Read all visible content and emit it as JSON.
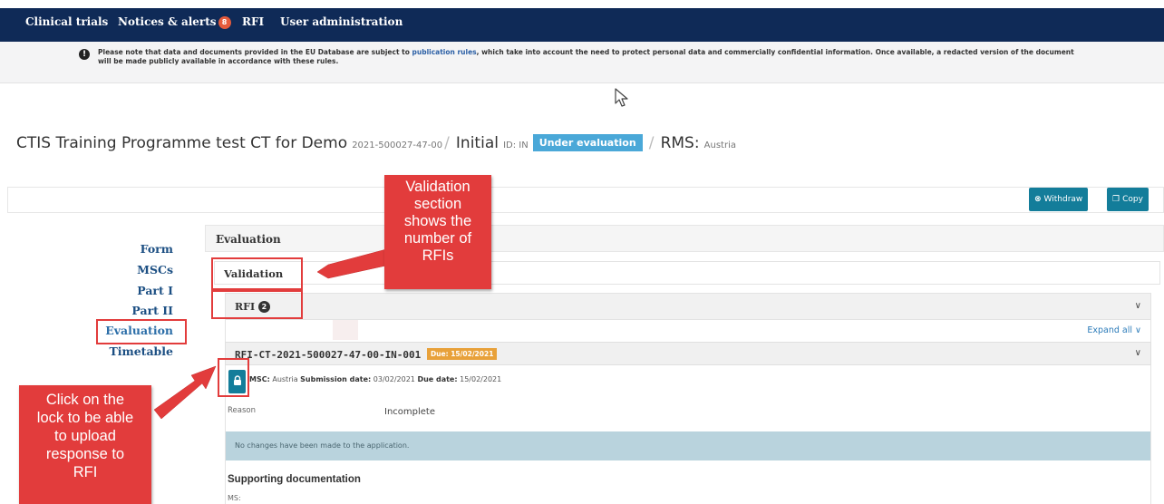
{
  "nav": {
    "items": [
      "Clinical trials",
      "Notices & alerts",
      "RFI",
      "User administration"
    ],
    "alerts_count": "8"
  },
  "notice": {
    "line1_before": "Please note that data and documents provided in the EU Database are subject to ",
    "line1_link": "publication rules",
    "line1_after": ", which take into account the need to protect personal data and commercially confidential information. Once available, a redacted version of the document",
    "line2": "will be made publicly available in accordance with these rules."
  },
  "trial": {
    "title": "CTIS Training Programme test CT for Demo",
    "number": "2021-500027-47-00",
    "phase": "Initial",
    "id_label": "ID: IN",
    "status": "Under evaluation",
    "rms_label": "RMS:",
    "rms_value": "Austria"
  },
  "actions": {
    "withdraw": "Withdraw",
    "copy": "Copy"
  },
  "sidebar": {
    "items": [
      "Form",
      "MSCs",
      "Part I",
      "Part II",
      "Evaluation",
      "Timetable"
    ],
    "active": "Evaluation"
  },
  "evaluation": {
    "header": "Evaluation",
    "validation": "Validation",
    "rfi_label": "RFI",
    "rfi_count": "2",
    "expand_all": "Expand all"
  },
  "rfi_item": {
    "id": "RFI-CT-2021-500027-47-00-IN-001",
    "due_badge": "Due: 15/02/2021",
    "msc_label": "MSC:",
    "msc_value": "Austria",
    "submission_label": "Submission date:",
    "submission_value": "03/02/2021",
    "due_label": "Due date:",
    "due_value": "15/02/2021",
    "reason_label": "Reason",
    "reason_value": "Incomplete",
    "info_message": "No changes have been made to the application.",
    "supporting_title": "Supporting documentation",
    "ms_label": "MS:"
  },
  "annotations": {
    "callout_validation": [
      "Validation",
      "section",
      "shows the",
      "number of",
      "RFIs"
    ],
    "callout_lock": [
      "Click on the",
      "lock to be able",
      "to upload",
      "response to",
      "RFI"
    ]
  },
  "colors": {
    "nav_bg": "#0f2a57",
    "status_badge": "#4aa8d8",
    "button": "#137d9a",
    "due_badge": "#e8a13a",
    "callout": "#e23c3c",
    "info_bar": "#b9d3dd"
  },
  "icons": {
    "notice": "info-circle-icon",
    "withdraw": "x-circle-icon",
    "copy": "copy-icon",
    "lock": "lock-icon",
    "chevron": "chevron-down-icon"
  }
}
